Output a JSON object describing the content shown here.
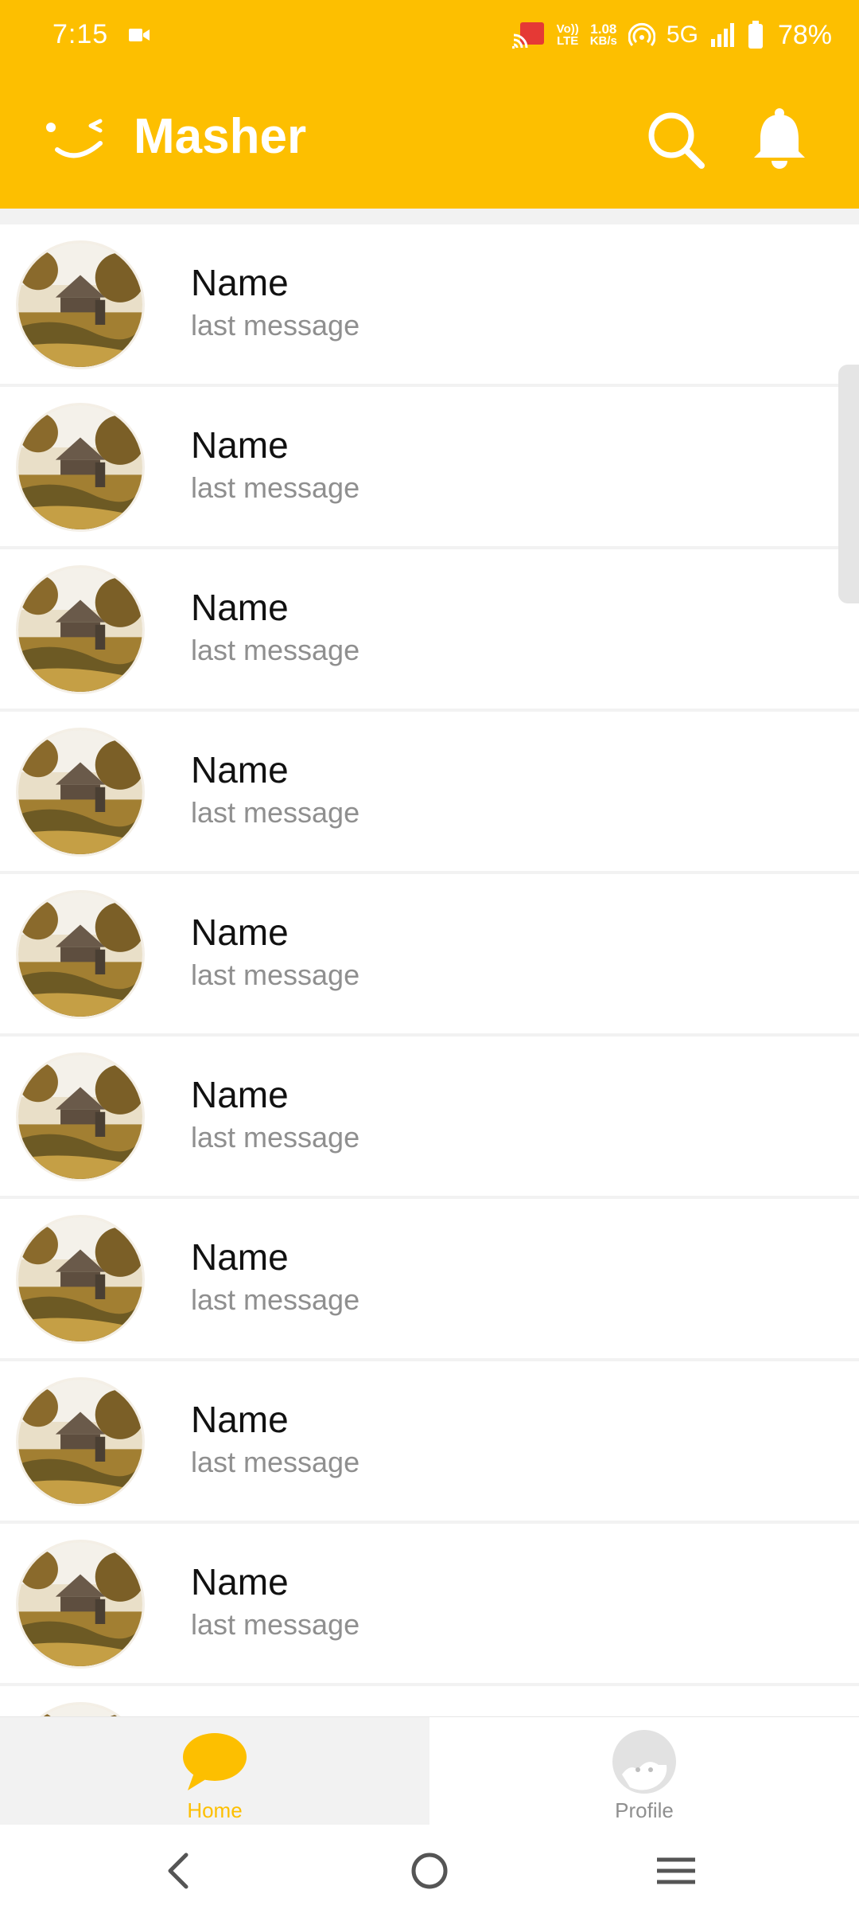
{
  "status_bar": {
    "time": "7:15",
    "lte_top": "Vo))",
    "lte_bottom": "LTE",
    "speed_top": "1.08",
    "speed_bottom": "KB/s",
    "network": "5G",
    "battery": "78%"
  },
  "app_bar": {
    "title": "Masher",
    "accent_color": "#FDBF00",
    "icons": [
      "wink-logo-icon",
      "search-icon",
      "bell-icon"
    ]
  },
  "chats": [
    {
      "name": "Name",
      "last_message": "last message"
    },
    {
      "name": "Name",
      "last_message": "last message"
    },
    {
      "name": "Name",
      "last_message": "last message"
    },
    {
      "name": "Name",
      "last_message": "last message"
    },
    {
      "name": "Name",
      "last_message": "last message"
    },
    {
      "name": "Name",
      "last_message": "last message"
    },
    {
      "name": "Name",
      "last_message": "last message"
    },
    {
      "name": "Name",
      "last_message": "last message"
    },
    {
      "name": "Name",
      "last_message": "last message"
    },
    {
      "name": "",
      "last_message": ""
    }
  ],
  "bottom_nav": {
    "home": {
      "label": "Home",
      "icon": "chat-bubble-icon",
      "active": true
    },
    "profile": {
      "label": "Profile",
      "icon": "profile-face-icon",
      "active": false
    }
  },
  "system_nav": {
    "icons": [
      "back-icon",
      "home-circle-icon",
      "recents-menu-icon"
    ]
  }
}
